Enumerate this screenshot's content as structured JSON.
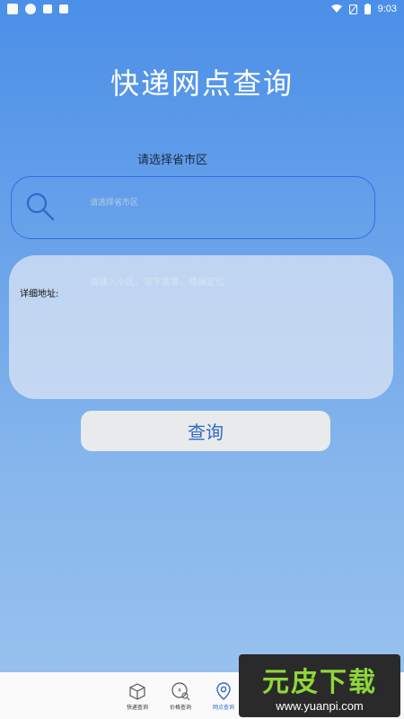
{
  "status_bar": {
    "time": "9:03"
  },
  "title": "快递网点查询",
  "region": {
    "label": "请选择省市区",
    "placeholder": "请选择省市区"
  },
  "address": {
    "label": "详细地址:",
    "placeholder": "请输入小区、写字楼等，精确定位"
  },
  "query_button": "查询",
  "bottom_nav": {
    "items": [
      {
        "label": "快递查询",
        "icon": "package-icon",
        "active": false
      },
      {
        "label": "价格查询",
        "icon": "price-search-icon",
        "active": false
      },
      {
        "label": "网点查询",
        "icon": "location-pin-icon",
        "active": true
      }
    ]
  },
  "watermark": {
    "logo": "元皮下载",
    "url": "www.yuanpi.com"
  },
  "colors": {
    "accent": "#2e6bc6",
    "border": "#2f6fe0"
  }
}
